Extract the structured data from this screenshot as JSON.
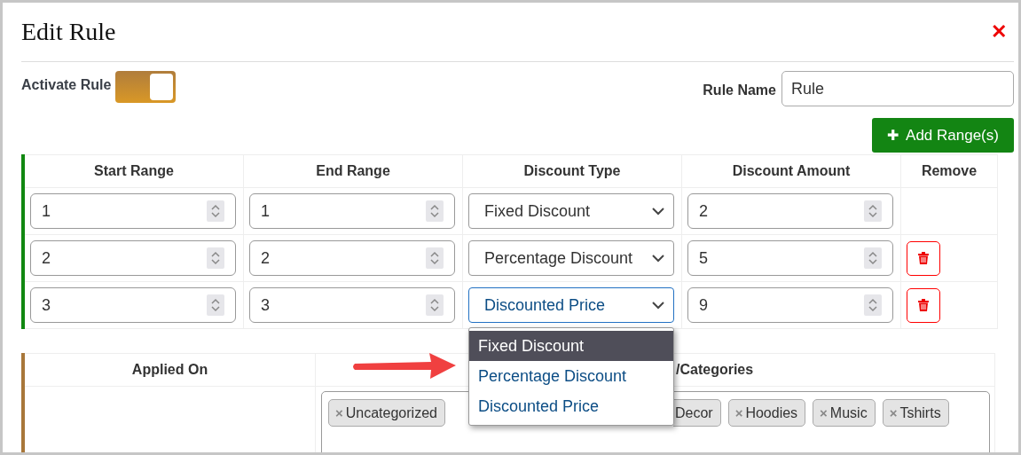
{
  "dialog": {
    "title": "Edit Rule",
    "close": "✕"
  },
  "activate": {
    "label": "Activate Rule",
    "on": true
  },
  "rule_name": {
    "label": "Rule Name",
    "value": "Rule"
  },
  "add_button": {
    "icon": "✚",
    "label": "Add Range(s)"
  },
  "ranges": {
    "columns": [
      "Start Range",
      "End Range",
      "Discount Type",
      "Discount Amount",
      "Remove"
    ],
    "rows": [
      {
        "start": "1",
        "end": "1",
        "type": "Fixed Discount",
        "amount": "2",
        "removable": false,
        "focused": false
      },
      {
        "start": "2",
        "end": "2",
        "type": "Percentage Discount",
        "amount": "5",
        "removable": true,
        "focused": false
      },
      {
        "start": "3",
        "end": "3",
        "type": "Discounted Price",
        "amount": "9",
        "removable": true,
        "focused": true
      }
    ]
  },
  "type_dropdown": {
    "options": [
      {
        "label": "Fixed Discount",
        "selected": true
      },
      {
        "label": "Percentage Discount",
        "selected": false
      },
      {
        "label": "Discounted Price",
        "selected": false
      }
    ]
  },
  "applied": {
    "columns": [
      "Applied On",
      "/Categories"
    ],
    "tags": [
      {
        "label": "Uncategorized",
        "kind": "full",
        "remove": "×"
      },
      {
        "label": "Decor",
        "kind": "partial"
      },
      {
        "label": "Hoodies",
        "kind": "full",
        "remove": "×"
      },
      {
        "label": "Music",
        "kind": "full",
        "remove": "×"
      },
      {
        "label": "Tshirts",
        "kind": "full",
        "remove": "×"
      }
    ]
  }
}
